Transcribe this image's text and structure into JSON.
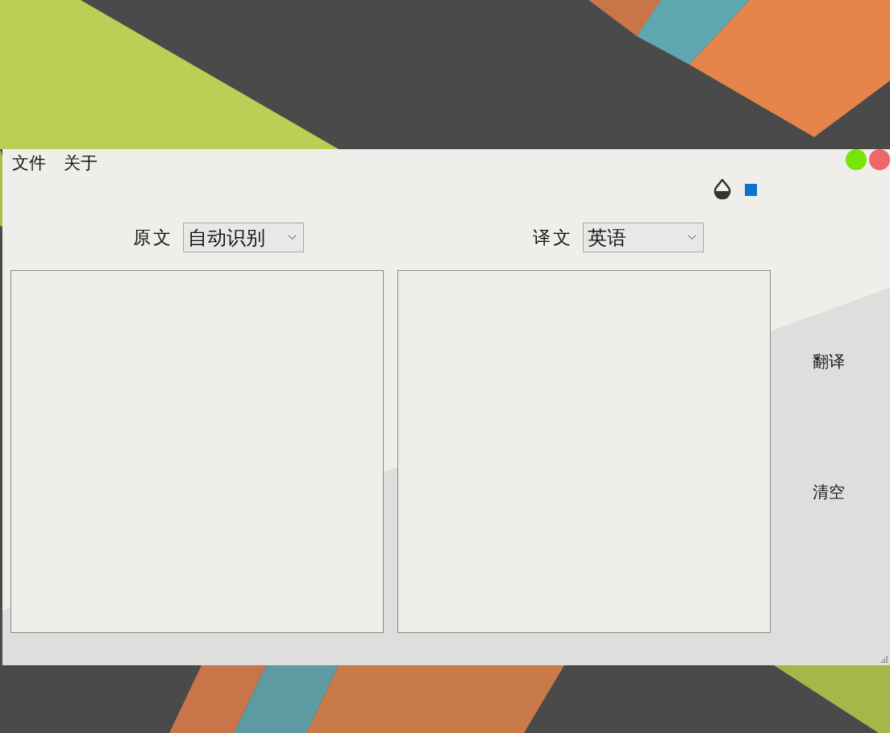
{
  "menu": [
    {
      "label": "文件"
    },
    {
      "label": "关于"
    }
  ],
  "window_controls": [
    {
      "color": "#77e40a"
    },
    {
      "color": "#ee6868"
    }
  ],
  "source": {
    "label": "原文",
    "language": "自动识别"
  },
  "target": {
    "label": "译文",
    "language": "英语"
  },
  "actions": [
    {
      "label": "翻译"
    },
    {
      "label": "清空"
    }
  ]
}
